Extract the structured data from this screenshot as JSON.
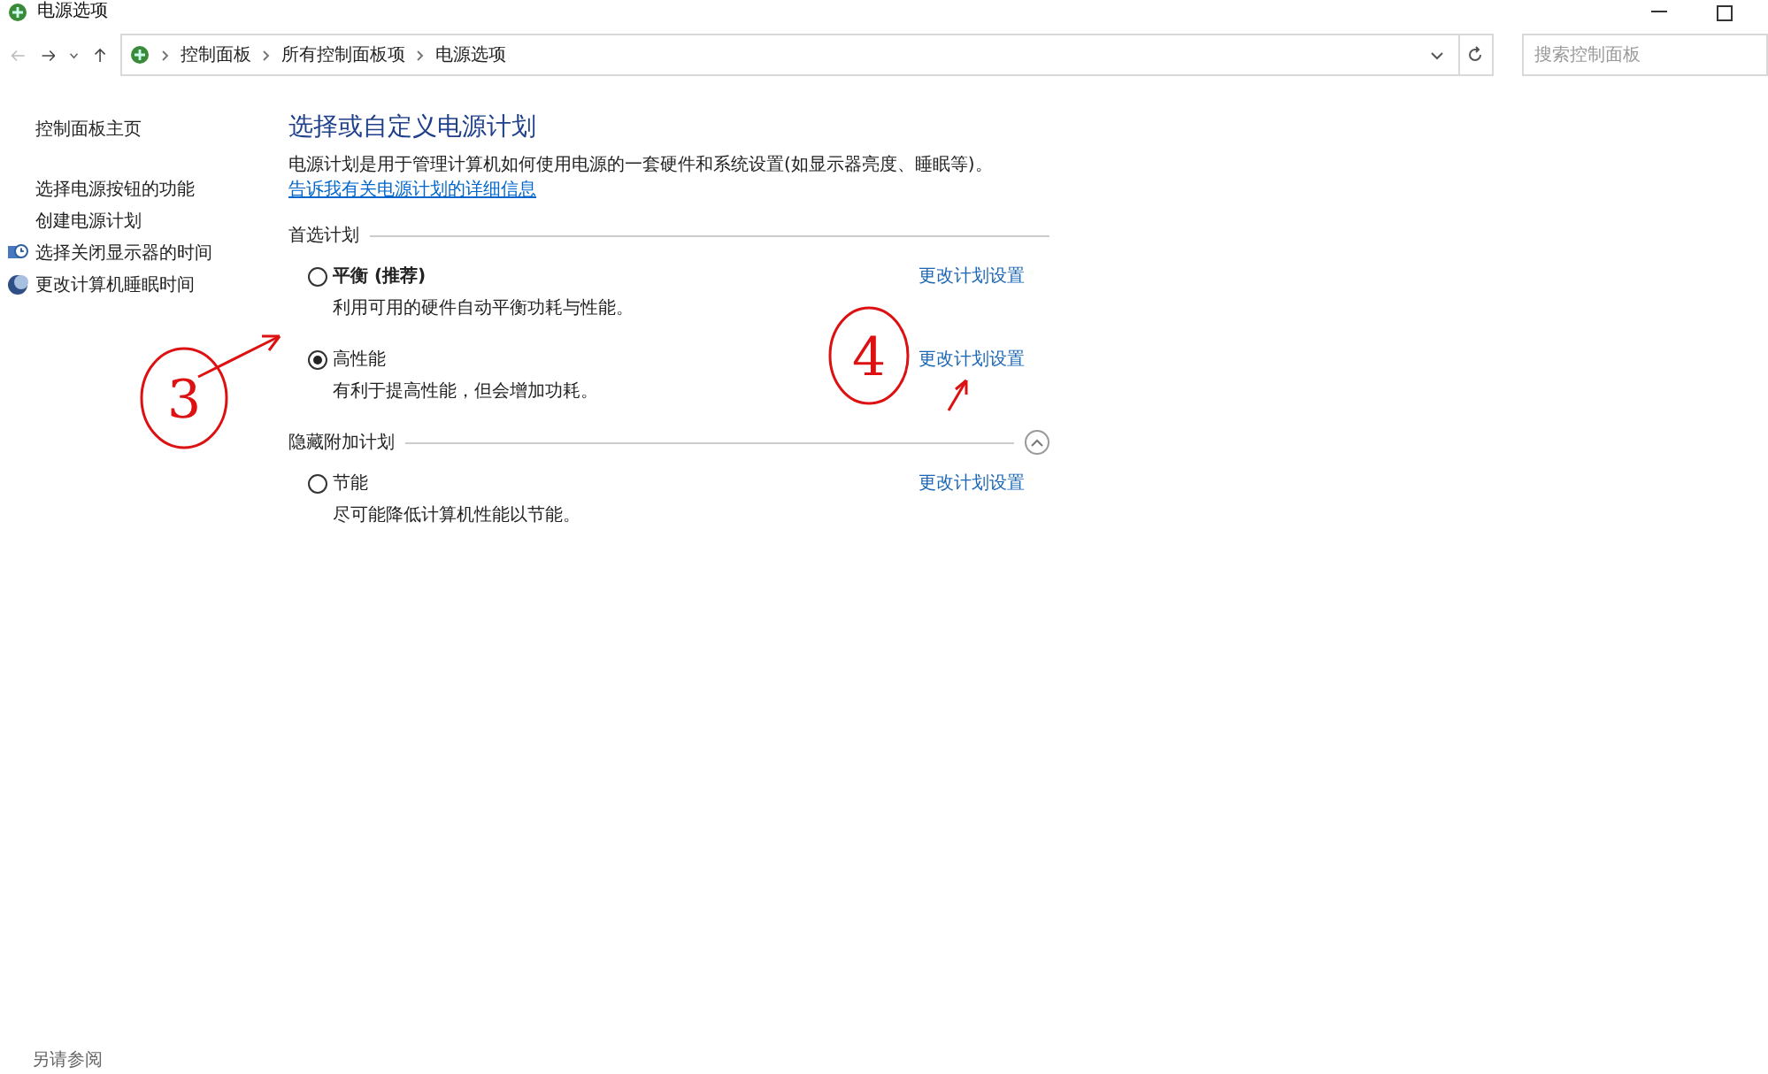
{
  "window": {
    "title": "电源选项"
  },
  "address_bar": {
    "breadcrumbs": [
      "控制面板",
      "所有控制面板项",
      "电源选项"
    ]
  },
  "search": {
    "placeholder": "搜索控制面板"
  },
  "sidebar": {
    "items": [
      {
        "label": "控制面板主页",
        "kind": "plain"
      },
      {
        "label": "选择电源按钮的功能",
        "kind": "plain"
      },
      {
        "label": "创建电源计划",
        "kind": "plain"
      },
      {
        "label": "选择关闭显示器的时间",
        "kind": "monitor"
      },
      {
        "label": "更改计算机睡眠时间",
        "kind": "moon"
      }
    ],
    "see_also": "另请参阅"
  },
  "main": {
    "heading": "选择或自定义电源计划",
    "description": "电源计划是用于管理计算机如何使用电源的一套硬件和系统设置(如显示器亮度、睡眠等)。",
    "link": "告诉我有关电源计划的详细信息",
    "groups": [
      {
        "title": "首选计划",
        "collapsible": false,
        "plans": [
          {
            "name": "平衡 (推荐)",
            "bold": true,
            "selected": false,
            "description": "利用可用的硬件自动平衡功耗与性能。",
            "action": "更改计划设置"
          },
          {
            "name": "高性能",
            "bold": false,
            "selected": true,
            "description": "有利于提高性能，但会增加功耗。",
            "action": "更改计划设置"
          }
        ]
      },
      {
        "title": "隐藏附加计划",
        "collapsible": true,
        "plans": [
          {
            "name": "节能",
            "bold": false,
            "selected": false,
            "description": "尽可能降低计算机性能以节能。",
            "action": "更改计划设置"
          }
        ]
      }
    ]
  },
  "annotations": [
    {
      "label": "3"
    },
    {
      "label": "4"
    }
  ]
}
